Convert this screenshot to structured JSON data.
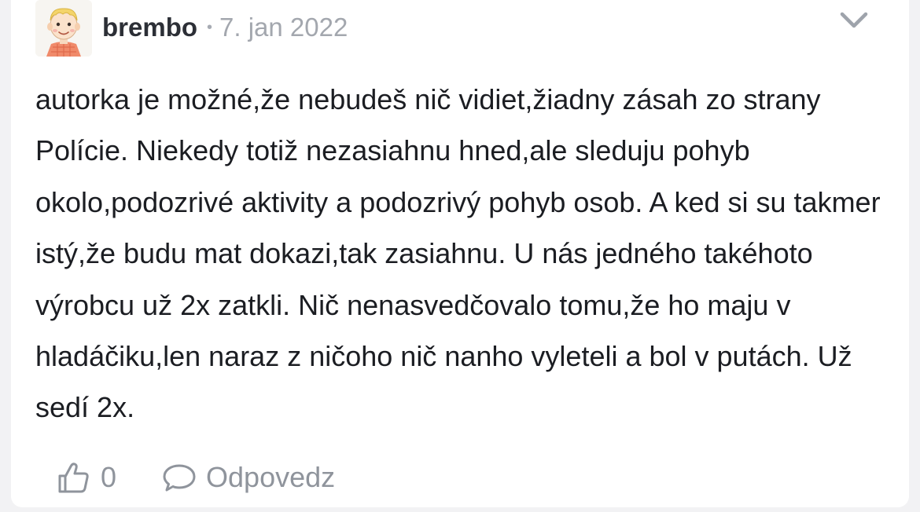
{
  "comment": {
    "author": "brembo",
    "separator": "•",
    "date": "7. jan 2022",
    "avatar_icon": "cartoon-boy-avatar",
    "collapse_icon": "chevron-down-icon",
    "body": "autorka je možné,že nebudeš nič vidiet,žiadny zásah zo strany Polície. Niekedy totiž nezasiahnu hned,ale sleduju pohyb okolo,podozrivé aktivity a podozrivý pohyb osob. A ked si su takmer istý,že budu mat dokazi,tak zasiahnu. U nás jedného takéhoto výrobcu už 2x zatkli. Nič nenasvedčovalo tomu,že ho maju v hladáčiku,len naraz z ničoho nič nanho vyleteli a bol v putách. Už sedí 2x.",
    "actions": {
      "like_icon": "thumbs-up-icon",
      "like_count": "0",
      "reply_icon": "speech-bubble-icon",
      "reply_label": "Odpovedz"
    }
  },
  "colors": {
    "background": "#f2f2f4",
    "card": "#ffffff",
    "text": "#1b1d22",
    "muted": "#8f949c",
    "username": "#2c2f36"
  }
}
